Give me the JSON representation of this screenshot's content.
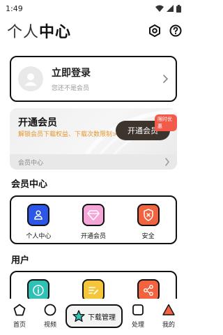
{
  "status": {
    "time": "1:49"
  },
  "header": {
    "title_light": "个人",
    "title_bold": "中心"
  },
  "login": {
    "title": "立即登录",
    "subtitle": "您还不是会员"
  },
  "vip": {
    "title": "开通会员",
    "desc": "解锁会员下载权益、下载次数限制>",
    "badge": "限时优惠",
    "button": "开通会员",
    "footer": "会员中心"
  },
  "member_section": {
    "title": "会员中心",
    "items": [
      {
        "label": "个人中心",
        "icon": "user-icon",
        "color": "#2c56e8"
      },
      {
        "label": "开通会员",
        "icon": "diamond-icon",
        "color": "#f4a6d8"
      },
      {
        "label": "安全",
        "icon": "shield-icon",
        "color": "#f2633f"
      }
    ]
  },
  "user_section": {
    "title": "用户",
    "items": [
      {
        "icon": "info-icon",
        "color": "#2fc2b4"
      },
      {
        "icon": "edit-icon",
        "color": "#f5c63a"
      },
      {
        "icon": "share-icon",
        "color": "#f2633f"
      }
    ]
  },
  "nav": {
    "items": [
      {
        "label": "首页",
        "icon": "pentagon-icon"
      },
      {
        "label": "视频",
        "icon": "circle-icon"
      },
      {
        "label": "下载管理",
        "icon": "star-icon",
        "color": "#2fc2b4"
      },
      {
        "label": "处理",
        "icon": "square-icon"
      },
      {
        "label": "我的",
        "icon": "triangle-icon",
        "color": "#f2633f"
      }
    ]
  }
}
